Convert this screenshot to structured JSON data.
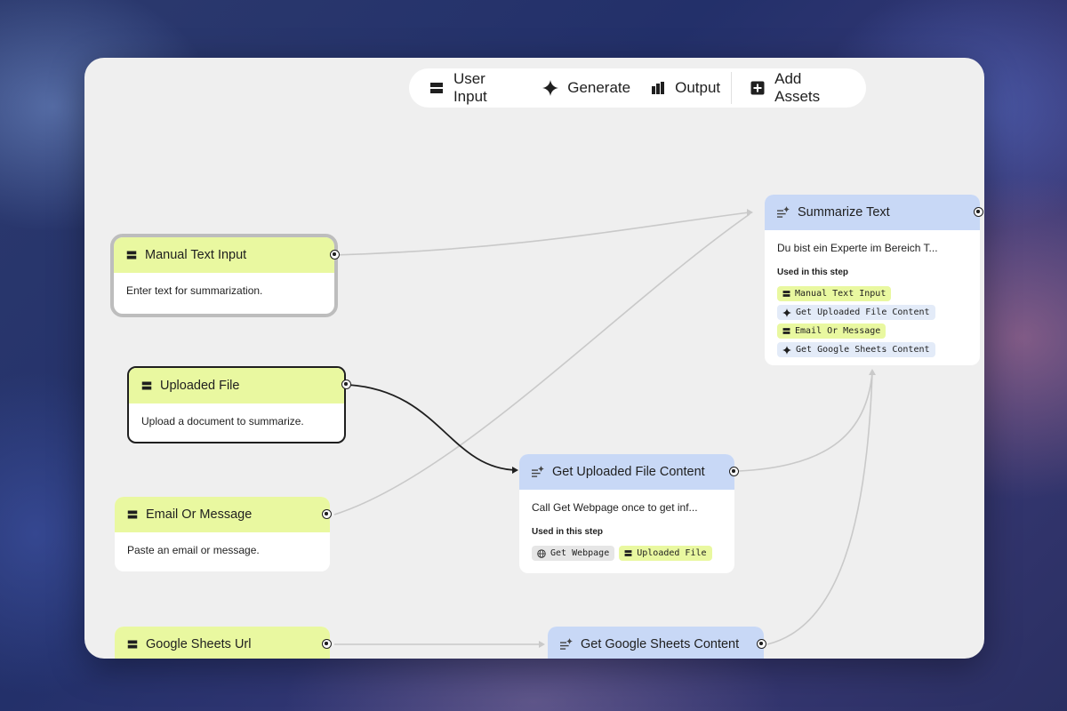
{
  "toolbar": {
    "user_input": "User Input",
    "generate": "Generate",
    "output": "Output",
    "add_assets": "Add Assets"
  },
  "nodes": {
    "manual_text_input": {
      "title": "Manual Text Input",
      "description": "Enter text for summarization."
    },
    "uploaded_file": {
      "title": "Uploaded File",
      "description": "Upload a document to summarize."
    },
    "email_or_message": {
      "title": "Email Or Message",
      "description": "Paste an email or message."
    },
    "google_sheets_url": {
      "title": "Google Sheets Url"
    },
    "summarize_text": {
      "title": "Summarize Text",
      "description": "Du bist ein Experte im Bereich T...",
      "used_label": "Used in this step",
      "used": [
        "Manual Text Input",
        "Get Uploaded File Content",
        "Email Or Message",
        "Get Google Sheets Content"
      ]
    },
    "get_uploaded_file_content": {
      "title": "Get Uploaded File Content",
      "description": "Call Get Webpage once to get inf...",
      "used_label": "Used in this step",
      "used": [
        "Get Webpage",
        "Uploaded File"
      ]
    },
    "get_google_sheets_content": {
      "title": "Get Google Sheets Content"
    }
  },
  "colors": {
    "input_header": "#e9f8a0",
    "generate_header": "#c8d8f6",
    "canvas": "#efefef",
    "edge": "#c9c9c9",
    "active_edge": "#1f1f1f"
  },
  "icons": {
    "user_input": "input-icon",
    "generate": "sparkle-icon",
    "output": "output-icon",
    "add_assets": "add-box-icon",
    "generate_node": "text-sparkle-icon",
    "tool": "globe-icon"
  }
}
